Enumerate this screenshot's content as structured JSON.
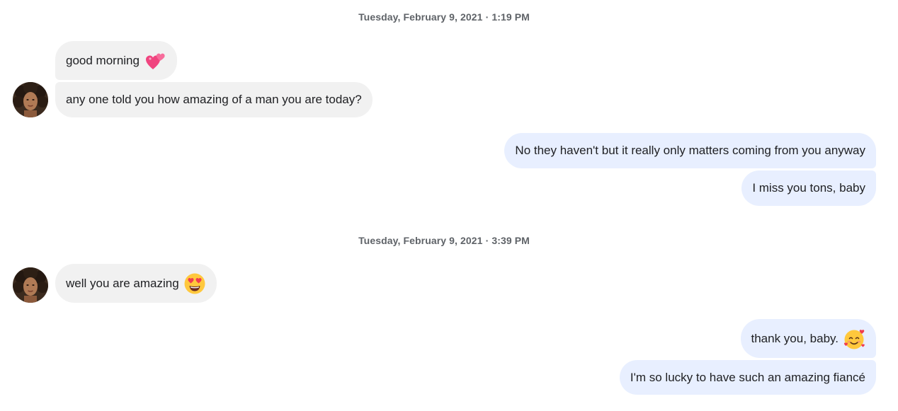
{
  "conversation": {
    "timestamp_1": "Tuesday, February 9, 2021 · 1:19 PM",
    "timestamp_2": "Tuesday, February 9, 2021 · 3:39 PM",
    "messages": [
      {
        "direction": "incoming",
        "text": "good morning",
        "emoji": "two-hearts-icon"
      },
      {
        "direction": "incoming",
        "text": "any one told you how amazing of a man you are today?"
      },
      {
        "direction": "outgoing",
        "text": "No they haven't but it really only matters coming from you anyway"
      },
      {
        "direction": "outgoing",
        "text": "I miss you tons, baby"
      },
      {
        "direction": "incoming",
        "text": "well you are amazing",
        "emoji": "heart-eyes-icon"
      },
      {
        "direction": "outgoing",
        "text": "thank you, baby.",
        "emoji": "smiling-face-with-hearts-icon"
      },
      {
        "direction": "outgoing",
        "text": "I'm so lucky to have such an amazing fiancé"
      }
    ]
  },
  "colors": {
    "incoming_bubble": "#f1f1f1",
    "outgoing_bubble": "#e8efff",
    "timestamp_text": "#5f6368",
    "message_text": "#202124"
  }
}
